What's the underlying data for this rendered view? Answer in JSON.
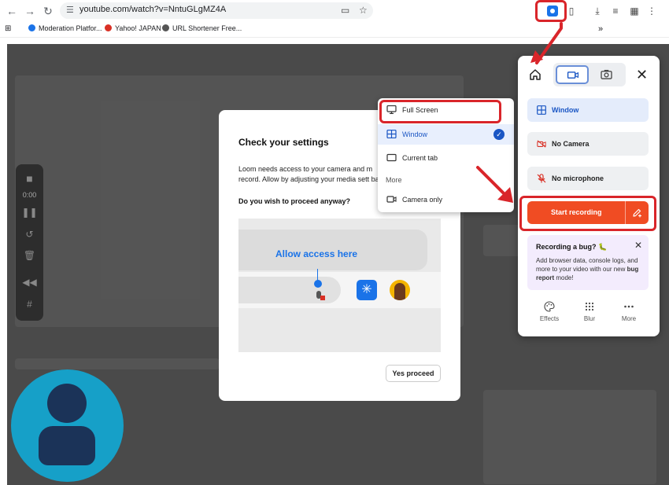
{
  "browser": {
    "url": "youtube.com/watch?v=NntuGLgMZ4A",
    "bookmarks": [
      {
        "label": "Moderation Platfor...",
        "color": "#1a73e8"
      },
      {
        "label": "Yahoo! JAPAN",
        "color": "#d93025"
      },
      {
        "label": "URL Shortener Free...",
        "color": "#555555"
      }
    ],
    "overflow_label": "»"
  },
  "recorder_toolbar": {
    "timer": "0:00"
  },
  "dialog": {
    "title": "Check your settings",
    "body": "Loom needs access to your camera and m record. Allow by adjusting your media sett bar.",
    "question": "Do you wish to proceed anyway?",
    "preview_text": "Allow access here",
    "proceed_button": "Yes proceed"
  },
  "dropdown": {
    "items": [
      {
        "label": "Full Screen",
        "icon": "monitor-icon",
        "selected": false
      },
      {
        "label": "Window",
        "icon": "window-grid-icon",
        "selected": true
      },
      {
        "label": "Current tab",
        "icon": "tab-icon",
        "selected": false
      }
    ],
    "section_label": "More",
    "more_items": [
      {
        "label": "Camera only",
        "icon": "camera-icon"
      }
    ]
  },
  "panel": {
    "mode_tabs": [
      "video-icon",
      "screenshot-icon"
    ],
    "rows": [
      {
        "label": "Window",
        "icon": "window-grid-icon",
        "style": "blue"
      },
      {
        "label": "No Camera",
        "icon": "camera-off-icon",
        "style": "grey"
      },
      {
        "label": "No microphone",
        "icon": "mic-off-icon",
        "style": "grey"
      }
    ],
    "start_button": "Start recording",
    "bug_card": {
      "title": "Recording a bug? 🐛",
      "text_before": "Add browser data, console logs, and more to your video with our new ",
      "text_bold": "bug report",
      "text_after": " mode!"
    },
    "footer": [
      {
        "label": "Effects",
        "icon": "palette-icon"
      },
      {
        "label": "Blur",
        "icon": "blur-icon"
      },
      {
        "label": "More",
        "icon": "more-dots-icon"
      }
    ]
  },
  "colors": {
    "loom_orange": "#f04c23",
    "accent_blue": "#1a56c4",
    "annotation_red": "#d9252a",
    "avatar_bg": "#16a0c8"
  }
}
